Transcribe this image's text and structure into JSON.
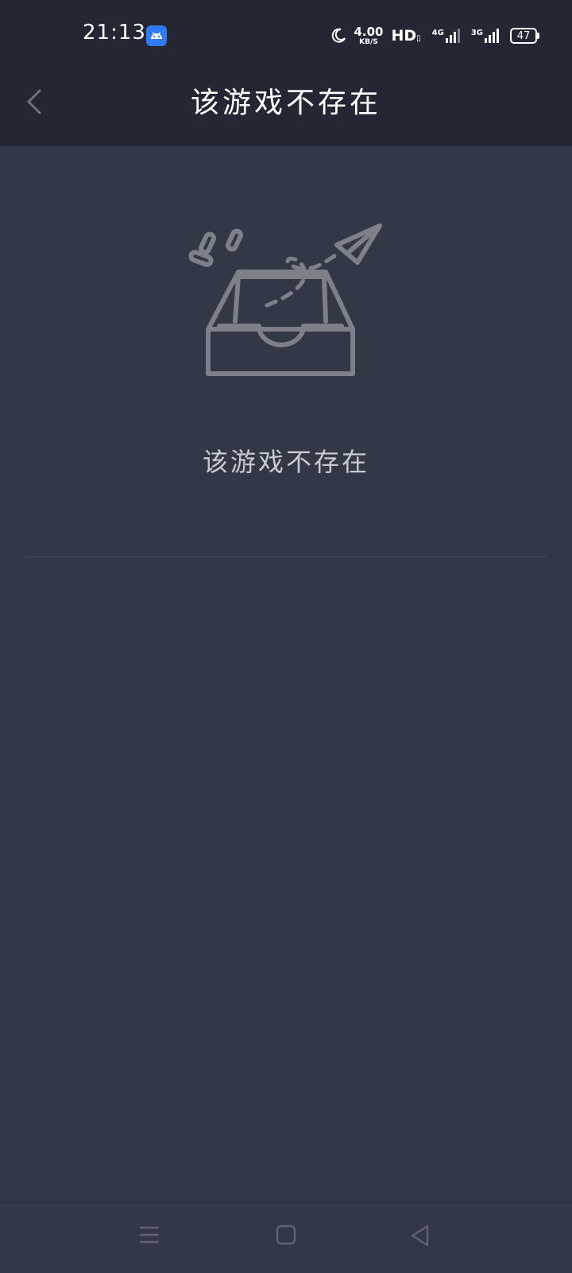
{
  "status_bar": {
    "time": "21:13",
    "speed_value": "4.00",
    "speed_unit": "KB/S",
    "hd_label": "HD",
    "net1_label": "4G",
    "net2_label": "3G",
    "battery_level": "47",
    "icons": [
      "android-app-icon",
      "moon-icon",
      "signal-icon",
      "battery-icon"
    ]
  },
  "header": {
    "title": "该游戏不存在",
    "back_icon": "chevron-left-icon"
  },
  "empty_state": {
    "illustration": "empty-box-paper-plane-icon",
    "message": "该游戏不存在"
  },
  "nav_bar": {
    "icons": [
      "menu-icon",
      "home-icon",
      "back-icon"
    ]
  },
  "colors": {
    "header_bg": "#242733",
    "page_bg": "#333847",
    "illustration": "#7e8089",
    "text_secondary": "#c8cad1"
  }
}
